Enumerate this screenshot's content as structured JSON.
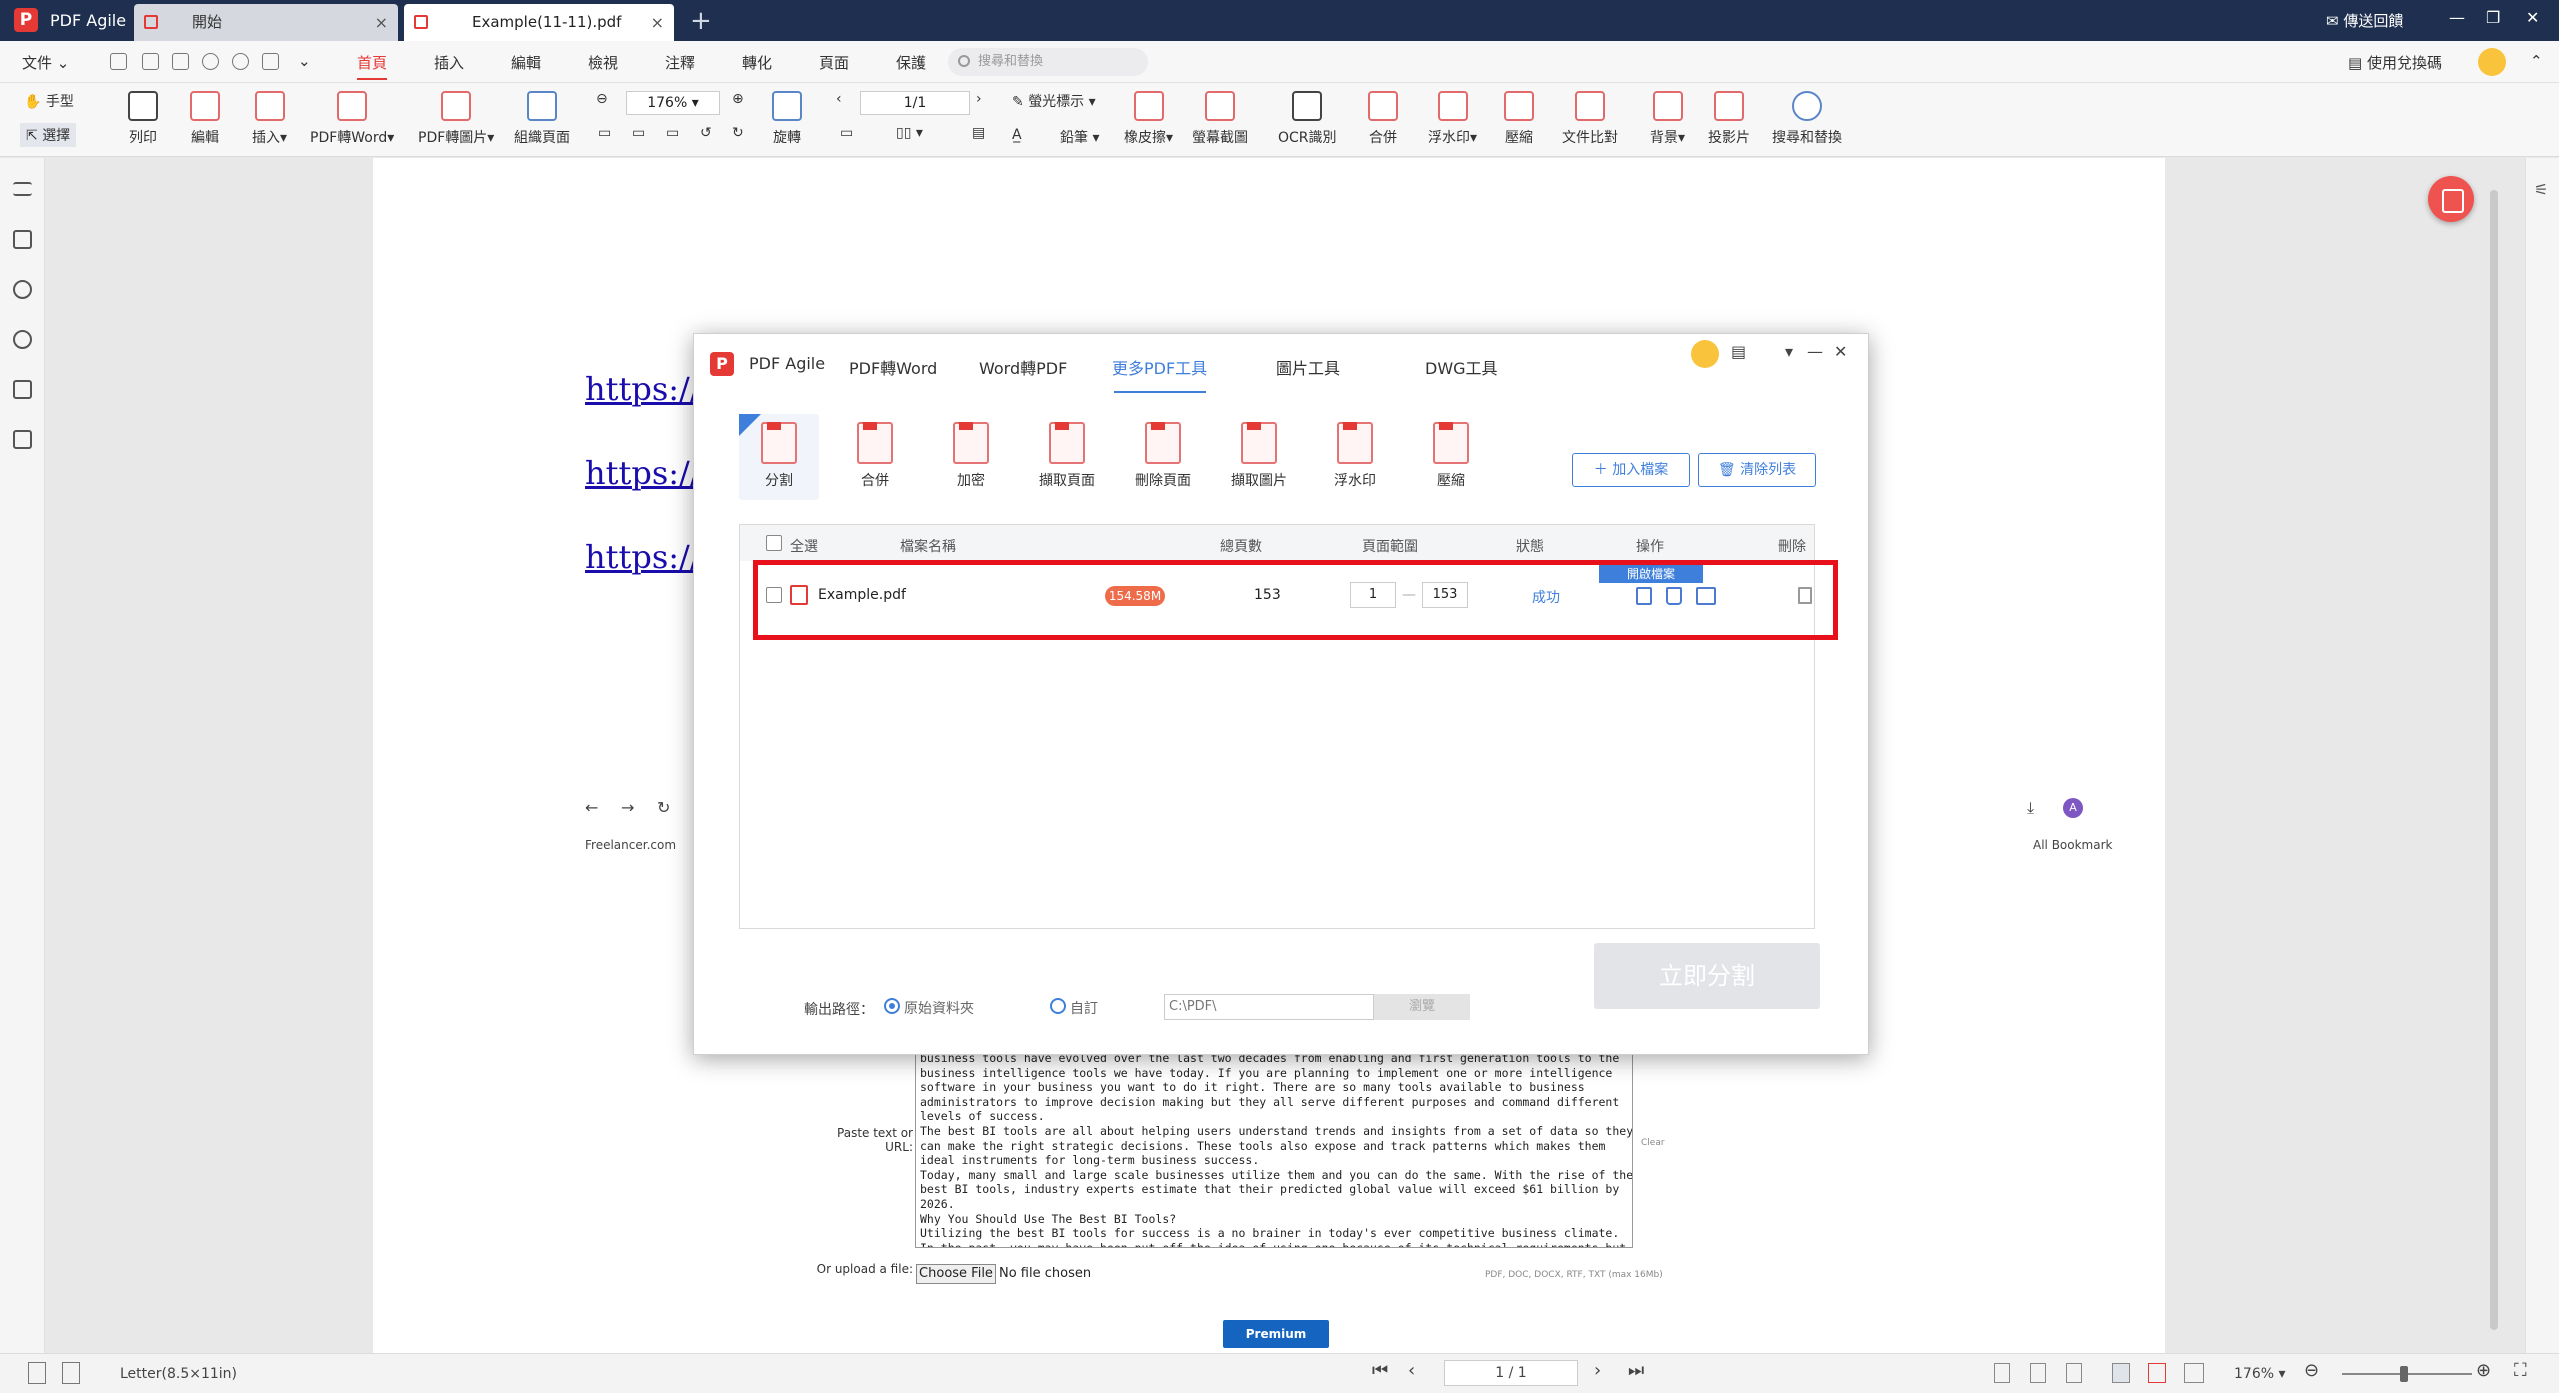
{
  "titlebar": {
    "app_name": "PDF Agile",
    "tabs": [
      {
        "label": "開始",
        "close": "×"
      },
      {
        "label": "Example(11-11).pdf",
        "close": "×"
      }
    ],
    "add_tab": "+",
    "feedback": "傳送回饋",
    "minimize": "—",
    "restore": "❐",
    "close": "✕"
  },
  "menu": {
    "file": "文件",
    "items": [
      "首頁",
      "插入",
      "編輯",
      "檢視",
      "注釋",
      "轉化",
      "頁面",
      "保護"
    ],
    "search_placeholder": "搜尋和替換",
    "redeem": "使用兌換碼"
  },
  "toolbar": {
    "hand": "手型",
    "select": "選擇",
    "print": "列印",
    "edit": "編輯",
    "insert": "插入",
    "pdf_to_word": "PDF轉Word",
    "pdf_to_image": "PDF轉圖片",
    "organize": "組織頁面",
    "zoom": "176%",
    "rotate": "旋轉",
    "page": "1/1",
    "highlight": "螢光標示",
    "pencil": "鉛筆",
    "eraser": "橡皮擦",
    "screenshot": "螢幕截圖",
    "ocr": "OCR識別",
    "merge": "合併",
    "watermark": "浮水印",
    "compress": "壓縮",
    "compare": "文件比對",
    "background": "背景",
    "slideshow": "投影片",
    "search_replace": "搜尋和替換"
  },
  "document": {
    "links": [
      "https://c",
      "https://z",
      "https://r"
    ],
    "browser": {
      "back": "←",
      "forward": "→",
      "reload": "↻",
      "bookmark": "Freelancer.com",
      "all_bookmarks": "All Bookmark",
      "avatar": "A"
    },
    "paste_label": "Paste text or URL:",
    "textarea_lines": [
      "business tools have evolved over the last two decades from enabling and first generation tools to the",
      "business intelligence tools we have today.  If you are planning to implement one or more intelligence",
      "software in your business you want to do it right. There are so many tools available to business",
      "administrators to improve decision making but they all serve different purposes and command different",
      "levels of success.",
      "The best BI tools are all about helping users understand trends and insights from a set of data so they",
      "can make the right strategic decisions. These tools also expose and track patterns which makes them",
      "ideal instruments for long-term business success.",
      "Today, many small and large scale businesses utilize them and you can do the same. With the rise of the",
      "best BI tools, industry experts estimate that their predicted global value will exceed $61 billion by",
      "2026.",
      "Why You Should Use The Best BI Tools?",
      "Utilizing the best BI tools for success is a no brainer in today's ever competitive business climate.",
      "In the past, you may have been put off the idea of using one because of its technical requirements but"
    ],
    "clear": "Clear",
    "upload_label": "Or upload a file:",
    "choose_file": "Choose File",
    "no_file": "No file chosen",
    "file_hint": "PDF, DOC, DOCX, RTF, TXT (max 16Mb)",
    "premium": "Premium Search"
  },
  "modal": {
    "title": "PDF Agile",
    "tabs": [
      "PDF轉Word",
      "Word轉PDF",
      "更多PDF工具",
      "圖片工具",
      "DWG工具"
    ],
    "active_tab": "更多PDF工具",
    "tools": [
      "分割",
      "合併",
      "加密",
      "擷取頁面",
      "刪除頁面",
      "擷取圖片",
      "浮水印",
      "壓縮"
    ],
    "add_file": "加入檔案",
    "clear_list": "清除列表",
    "columns": {
      "select_all": "全選",
      "file_name": "檔案名稱",
      "total_pages": "總頁數",
      "page_range": "頁面範圍",
      "status": "狀態",
      "action": "操作",
      "delete": "刪除"
    },
    "rows": [
      {
        "name": "Example.pdf",
        "size": "154.58M",
        "pages": "153",
        "range_from": "1",
        "range_to": "153",
        "status": "成功"
      }
    ],
    "open_file_tip": "開啟檔案",
    "output_label": "輸出路徑：",
    "option_original": "原始資料夾",
    "option_custom": "自訂",
    "path": "C:\\PDF\\",
    "browse": "瀏覽",
    "split_now": "立即分割",
    "controls": {
      "menu": "▾",
      "minimize": "—",
      "close": "✕"
    }
  },
  "statusbar": {
    "page_size": "Letter(8.5×11in)",
    "page": "1 / 1",
    "zoom": "176%"
  },
  "colors": {
    "titlebar": "#1e2f4f",
    "accent_red": "#e53935",
    "accent_blue": "#3f7fdc",
    "highlight_border": "#e8111b"
  }
}
